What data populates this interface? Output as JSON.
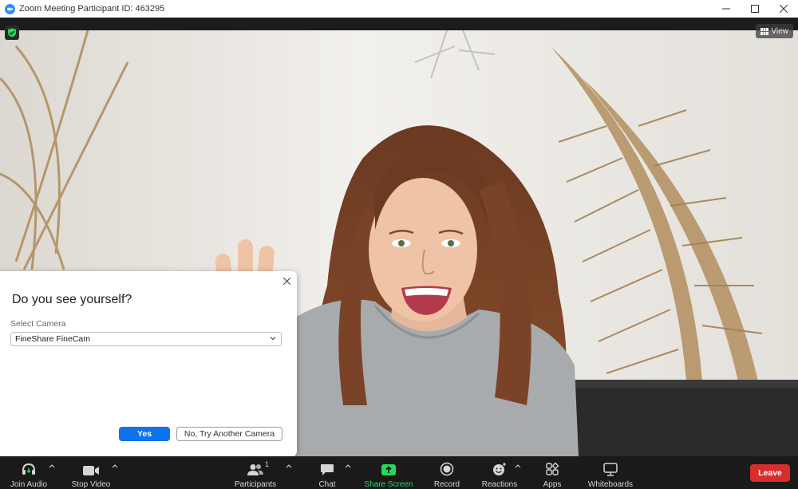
{
  "window": {
    "title": "Zoom Meeting Participant ID: 463295",
    "controls": [
      "minimize",
      "maximize",
      "close"
    ]
  },
  "video": {
    "view_label": "View"
  },
  "dialog": {
    "title": "Do you see yourself?",
    "camera_label": "Select Camera",
    "camera_value": "FineShare FineCam",
    "yes_label": "Yes",
    "no_label": "No, Try Another Camera"
  },
  "toolbar": {
    "join_audio": "Join Audio",
    "stop_video": "Stop Video",
    "participants": "Participants",
    "participants_count": "1",
    "chat": "Chat",
    "share_screen": "Share Screen",
    "record": "Record",
    "reactions": "Reactions",
    "apps": "Apps",
    "whiteboards": "Whiteboards",
    "leave": "Leave"
  },
  "colors": {
    "zoom_blue": "#2d8cff",
    "primary_button": "#0e72ed",
    "share_green": "#23d959",
    "leave_red": "#d82d2d",
    "toolbar_bg": "#1a1a1a"
  }
}
